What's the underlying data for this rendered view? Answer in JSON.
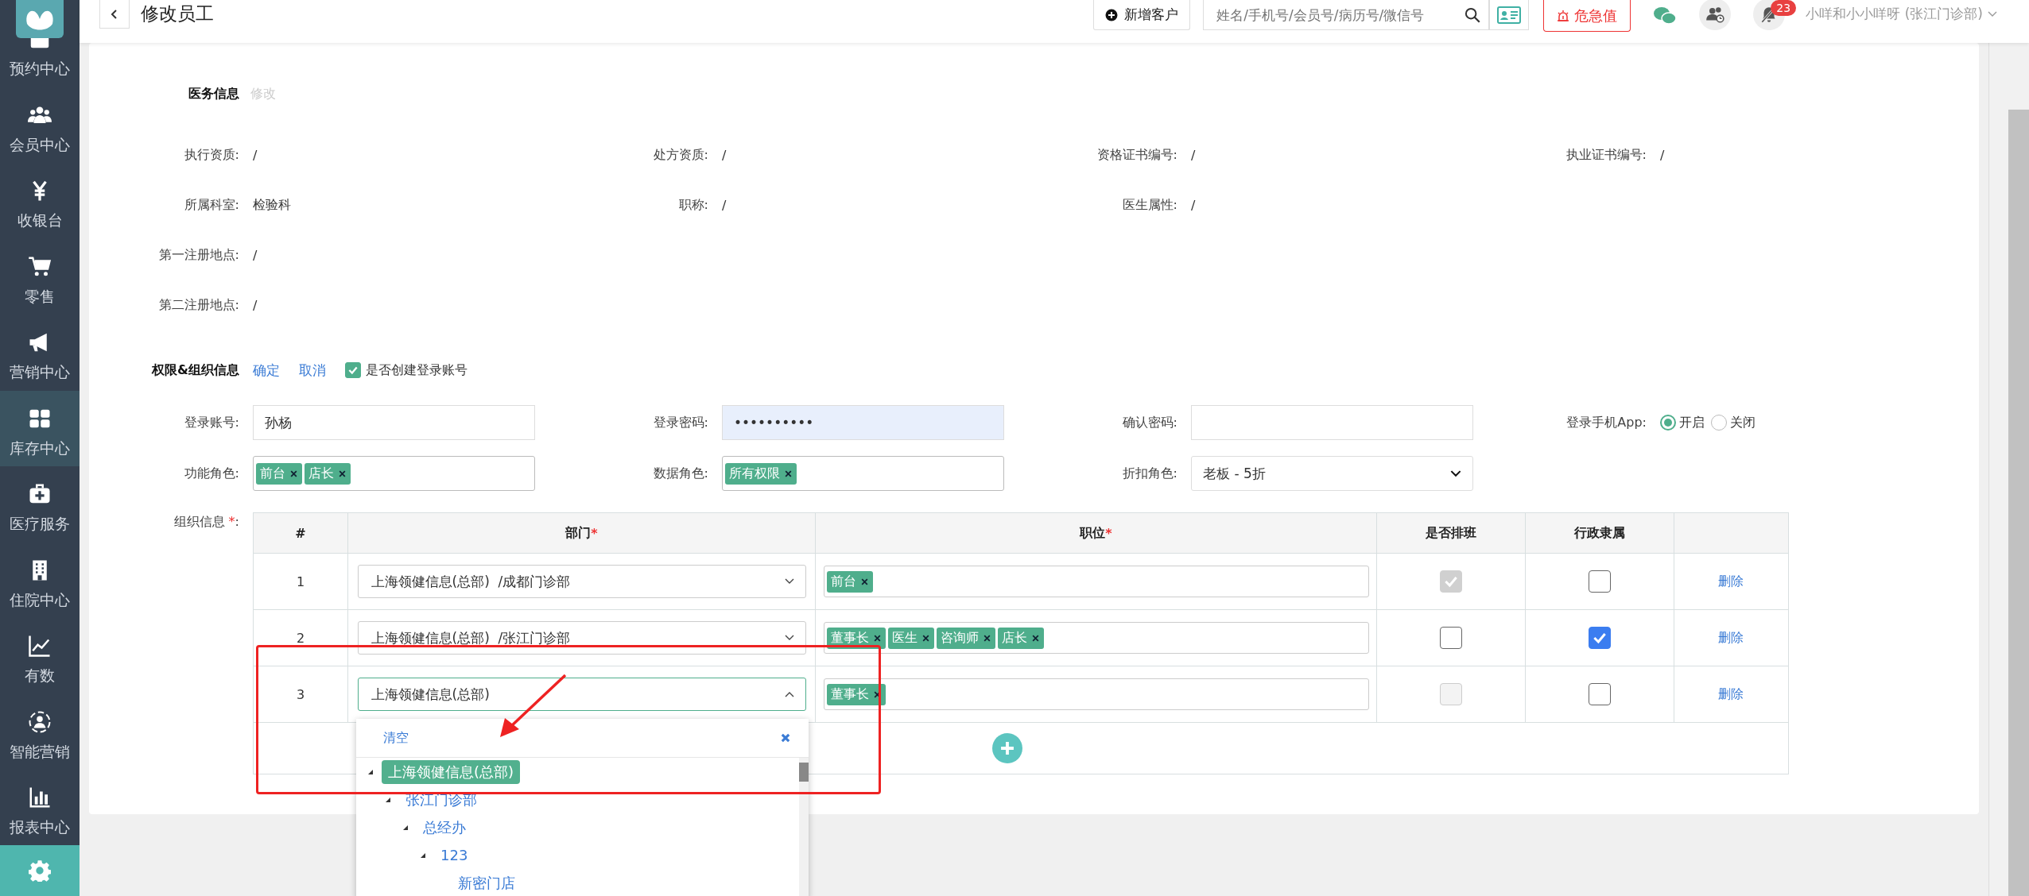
{
  "sidebar": {
    "items": [
      {
        "label": "预约中心",
        "selected": false
      },
      {
        "label": "会员中心",
        "selected": false
      },
      {
        "label": "收银台",
        "selected": false
      },
      {
        "label": "零售",
        "selected": false
      },
      {
        "label": "营销中心",
        "selected": false
      },
      {
        "label": "库存中心",
        "selected": true
      },
      {
        "label": "医疗服务",
        "selected": false
      },
      {
        "label": "住院中心",
        "selected": false
      },
      {
        "label": "有数",
        "selected": false
      },
      {
        "label": "智能营销",
        "selected": false
      },
      {
        "label": "报表中心",
        "selected": false
      }
    ]
  },
  "topbar": {
    "title": "修改员工",
    "new_customer": "新增客户",
    "search": {
      "placeholder": "姓名/手机号/会员号/病历号/微信号"
    },
    "alert_button": "危急值",
    "notification_count": "23",
    "user": "小咩和小小咩呀 (张江门诊部)"
  },
  "medical_info": {
    "title": "医务信息",
    "edit": "修改",
    "rows": [
      [
        {
          "label": "执行资质:",
          "value": "/"
        },
        {
          "label": "处方资质:",
          "value": "/"
        },
        {
          "label": "资格证书编号:",
          "value": "/"
        },
        {
          "label": "执业证书编号:",
          "value": "/"
        }
      ],
      [
        {
          "label": "所属科室:",
          "value": "检验科"
        },
        {
          "label": "职称:",
          "value": "/"
        },
        {
          "label": "医生属性:",
          "value": "/"
        }
      ],
      [
        {
          "label": "第一注册地点:",
          "value": "/"
        }
      ],
      [
        {
          "label": "第二注册地点:",
          "value": "/"
        }
      ]
    ]
  },
  "permissions": {
    "title": "权限&组织信息",
    "confirm": "确定",
    "cancel": "取消",
    "create_account": {
      "label": "是否创建登录账号",
      "checked": true
    },
    "login_account": {
      "label": "登录账号:",
      "value": "孙杨"
    },
    "password": {
      "label": "登录密码:",
      "value": "••••••••••"
    },
    "confirm_password": {
      "label": "确认密码:"
    },
    "app_login": {
      "label": "登录手机App:",
      "options": [
        {
          "label": "开启",
          "selected": true
        },
        {
          "label": "关闭",
          "selected": false
        }
      ]
    },
    "function_roles": {
      "label": "功能角色:",
      "tags": [
        "前台",
        "店长"
      ]
    },
    "data_roles": {
      "label": "数据角色:",
      "tags": [
        "所有权限"
      ]
    },
    "discount_role": {
      "label": "折扣角色:",
      "value": "老板 - 5折"
    }
  },
  "organization": {
    "label": "组织信息",
    "mark": "*",
    "colon": ":",
    "columns": [
      {
        "label": "#"
      },
      {
        "label": "部门",
        "mark": "*"
      },
      {
        "label": "职位",
        "mark": "*"
      },
      {
        "label": "是否排班"
      },
      {
        "label": "行政隶属"
      }
    ],
    "rows": [
      {
        "index": "1",
        "department": "上海领健信息(总部)  /成都门诊部",
        "open": false,
        "positions": [
          "前台"
        ],
        "shift": {
          "checked": true,
          "disabled": true
        },
        "admin": {
          "checked": false
        },
        "delete": "删除"
      },
      {
        "index": "2",
        "department": "上海领健信息(总部)  /张江门诊部",
        "open": false,
        "positions": [
          "董事长",
          "医生",
          "咨询师",
          "店长"
        ],
        "shift": {
          "checked": false,
          "disabled": false
        },
        "admin": {
          "checked": true
        },
        "delete": "删除"
      },
      {
        "index": "3",
        "department": "上海领健信息(总部)",
        "open": true,
        "positions": [
          "董事长"
        ],
        "shift": {
          "checked": false,
          "disabled": true
        },
        "admin": {
          "checked": false
        },
        "delete": "删除"
      }
    ],
    "dropdown": {
      "clear": "清空",
      "tree": [
        {
          "label": "上海领健信息(总部)",
          "selected": true,
          "expanded": true,
          "children": [
            {
              "label": "张江门诊部",
              "selected": false,
              "expanded": true,
              "children": [
                {
                  "label": "总经办",
                  "selected": false,
                  "expanded": true,
                  "children": [
                    {
                      "label": "123",
                      "selected": false,
                      "expanded": true,
                      "children": [
                        {
                          "label": "新密门店",
                          "selected": false
                        }
                      ]
                    }
                  ]
                }
              ]
            }
          ]
        }
      ]
    }
  }
}
